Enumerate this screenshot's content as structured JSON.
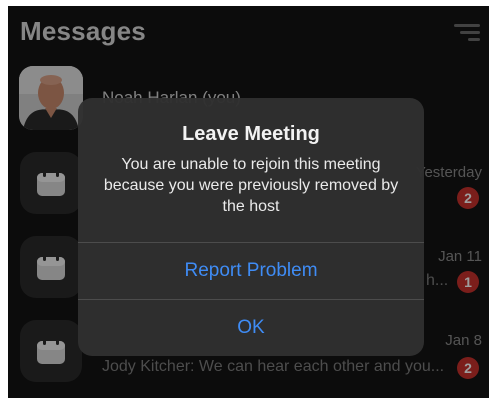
{
  "header": {
    "title": "Messages",
    "filter_icon": "filter-lines-icon"
  },
  "conversations": [
    {
      "name": "Noah Harlan (you)",
      "avatar": "profile-photo"
    },
    {
      "icon": "calendar-icon",
      "date": "Yesterday",
      "unread": "2"
    },
    {
      "icon": "calendar-icon",
      "date": "Jan 11",
      "preview": "h...",
      "unread": "1"
    },
    {
      "icon": "calendar-icon",
      "date": "Jan 8",
      "preview": "Jody Kitcher: We can hear each other and you...",
      "unread": "2"
    }
  ],
  "dialog": {
    "title": "Leave Meeting",
    "message": "You are unable to rejoin this meeting because you were previously removed by the host",
    "report_button": "Report Problem",
    "ok_button": "OK"
  },
  "colors": {
    "background": "#141414",
    "dialog_bg": "#303030",
    "accent_blue": "#3f8cf5",
    "badge_red": "#c7312d"
  }
}
